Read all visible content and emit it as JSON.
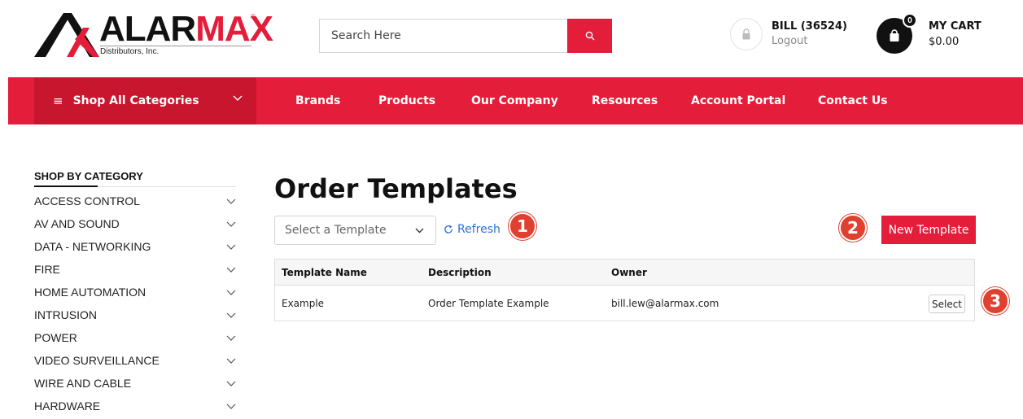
{
  "header": {
    "logo": {
      "word_dark": "ALAR",
      "word_red": "MAX",
      "reg_mark": "®",
      "sub": "Distributors, Inc."
    },
    "search": {
      "placeholder": "Search Here"
    },
    "account": {
      "name": "BILL (36524)",
      "logout": "Logout"
    },
    "cart": {
      "badge": "0",
      "label": "MY CART",
      "total": "$0.00"
    }
  },
  "nav": {
    "shop_all": "Shop All Categories",
    "links": [
      "Brands",
      "Products",
      "Our Company",
      "Resources",
      "Account Portal",
      "Contact Us"
    ]
  },
  "sidebar": {
    "title": "SHOP BY CATEGORY",
    "items": [
      "ACCESS CONTROL",
      "AV AND SOUND",
      "DATA - NETWORKING",
      "FIRE",
      "HOME AUTOMATION",
      "INTRUSION",
      "POWER",
      "VIDEO SURVEILLANCE",
      "WIRE AND CABLE",
      "HARDWARE"
    ]
  },
  "main": {
    "title": "Order Templates",
    "select_placeholder": "Select a Template",
    "refresh_label": "Refresh",
    "new_template_label": "New Template",
    "steps": [
      "1",
      "2",
      "3"
    ],
    "table": {
      "columns": [
        "Template Name",
        "Description",
        "Owner"
      ],
      "rows": [
        {
          "name": "Example",
          "description": "Order Template Example",
          "owner": "bill.lew@alarmax.com",
          "action": "Select"
        }
      ]
    }
  },
  "colors": {
    "brand_red": "#e31d3a",
    "brand_red_dark": "#c8162f",
    "step_red": "#e0402f",
    "link_blue": "#2a72d6"
  }
}
